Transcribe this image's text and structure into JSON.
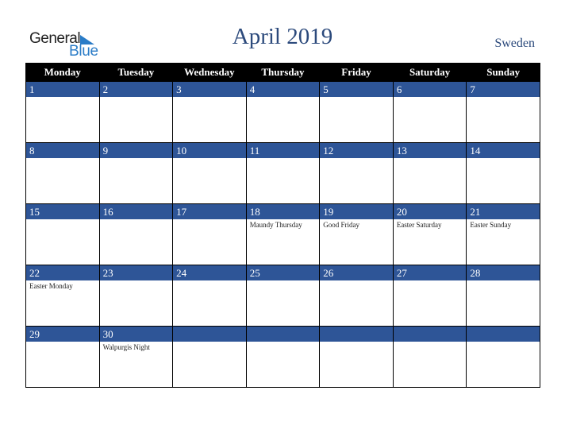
{
  "logo": {
    "line1": "General",
    "line2": "Blue"
  },
  "title": "April 2019",
  "country": "Sweden",
  "colors": {
    "header_bg": "#000000",
    "day_bar": "#2e5597",
    "title": "#2c4a7c",
    "logo_blue": "#2a7cc7"
  },
  "weekdays": [
    "Monday",
    "Tuesday",
    "Wednesday",
    "Thursday",
    "Friday",
    "Saturday",
    "Sunday"
  ],
  "weeks": [
    [
      {
        "day": "1",
        "event": ""
      },
      {
        "day": "2",
        "event": ""
      },
      {
        "day": "3",
        "event": ""
      },
      {
        "day": "4",
        "event": ""
      },
      {
        "day": "5",
        "event": ""
      },
      {
        "day": "6",
        "event": ""
      },
      {
        "day": "7",
        "event": ""
      }
    ],
    [
      {
        "day": "8",
        "event": ""
      },
      {
        "day": "9",
        "event": ""
      },
      {
        "day": "10",
        "event": ""
      },
      {
        "day": "11",
        "event": ""
      },
      {
        "day": "12",
        "event": ""
      },
      {
        "day": "13",
        "event": ""
      },
      {
        "day": "14",
        "event": ""
      }
    ],
    [
      {
        "day": "15",
        "event": ""
      },
      {
        "day": "16",
        "event": ""
      },
      {
        "day": "17",
        "event": ""
      },
      {
        "day": "18",
        "event": "Maundy Thursday"
      },
      {
        "day": "19",
        "event": "Good Friday"
      },
      {
        "day": "20",
        "event": "Easter Saturday"
      },
      {
        "day": "21",
        "event": "Easter Sunday"
      }
    ],
    [
      {
        "day": "22",
        "event": "Easter Monday"
      },
      {
        "day": "23",
        "event": ""
      },
      {
        "day": "24",
        "event": ""
      },
      {
        "day": "25",
        "event": ""
      },
      {
        "day": "26",
        "event": ""
      },
      {
        "day": "27",
        "event": ""
      },
      {
        "day": "28",
        "event": ""
      }
    ],
    [
      {
        "day": "29",
        "event": ""
      },
      {
        "day": "30",
        "event": "Walpurgis Night"
      },
      {
        "day": "",
        "event": ""
      },
      {
        "day": "",
        "event": ""
      },
      {
        "day": "",
        "event": ""
      },
      {
        "day": "",
        "event": ""
      },
      {
        "day": "",
        "event": ""
      }
    ]
  ]
}
